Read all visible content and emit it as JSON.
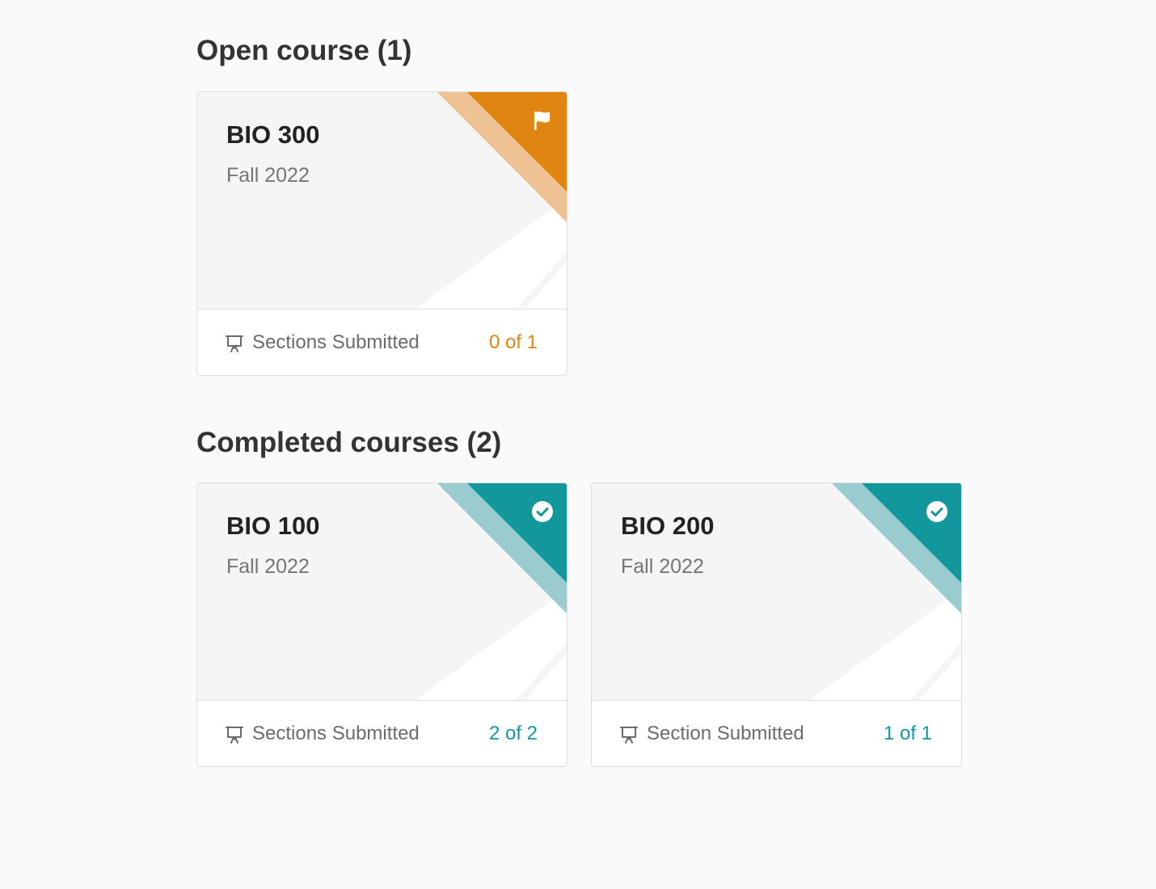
{
  "colors": {
    "page_background": "#fafafa",
    "heading_text": "#333333",
    "card_background": "#f5f5f5",
    "open_accent": "#e08412",
    "open_accent_light": "#efc294",
    "completed_accent": "#12979c",
    "completed_accent_light": "#9acbcf",
    "muted_text": "#6b6b6b"
  },
  "sections": [
    {
      "heading": "Open course (1)",
      "cards": [
        {
          "title": "BIO 300",
          "term": "Fall 2022",
          "status": "open",
          "status_icon": "flag-icon",
          "footer_icon": "presentation-icon",
          "footer_label": "Sections Submitted",
          "count_text": "0 of 1",
          "count_color": "#e08412"
        }
      ]
    },
    {
      "heading": "Completed courses (2)",
      "cards": [
        {
          "title": "BIO 100",
          "term": "Fall 2022",
          "status": "completed",
          "status_icon": "check-circle-icon",
          "footer_icon": "presentation-icon",
          "footer_label": "Sections Submitted",
          "count_text": "2 of 2",
          "count_color": "#12979c"
        },
        {
          "title": "BIO 200",
          "term": "Fall 2022",
          "status": "completed",
          "status_icon": "check-circle-icon",
          "footer_icon": "presentation-icon",
          "footer_label": "Section Submitted",
          "count_text": "1 of 1",
          "count_color": "#12979c"
        }
      ]
    }
  ]
}
